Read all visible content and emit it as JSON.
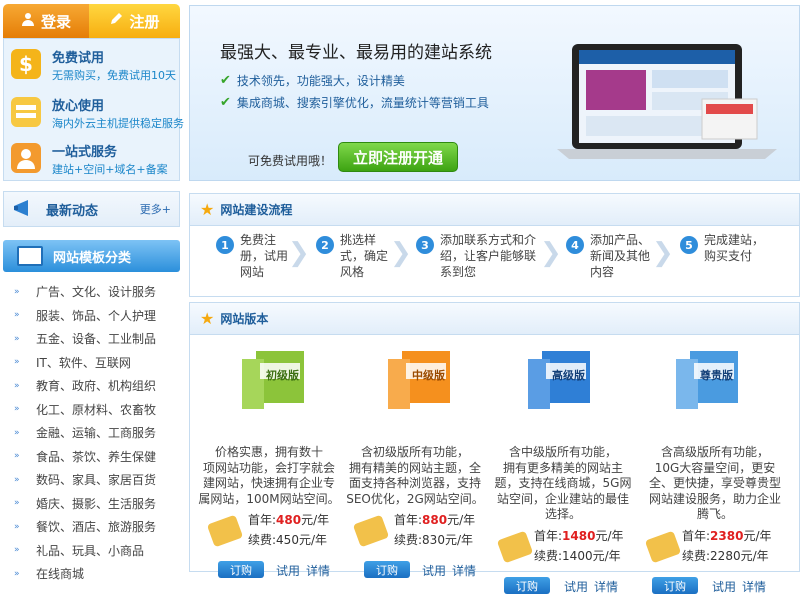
{
  "auth": {
    "login_label": "登录",
    "register_label": "注册"
  },
  "perks": [
    {
      "title": "免费试用",
      "desc": "无需购买，免费试用10天",
      "icon": "dollar-icon"
    },
    {
      "title": "放心使用",
      "desc": "海内外云主机提供稳定服务",
      "icon": "server-icon"
    },
    {
      "title": "一站式服务",
      "desc": "建站+空间+域名+备案",
      "icon": "user-service-icon"
    }
  ],
  "news": {
    "title": "最新动态",
    "more": "更多+"
  },
  "templates": {
    "title": "网站模板分类",
    "items": [
      "广告、文化、设计服务",
      "服装、饰品、个人护理",
      "五金、设备、工业制品",
      "IT、软件、互联网",
      "教育、政府、机构组织",
      "化工、原材料、农畜牧",
      "金融、运输、工商服务",
      "食品、茶饮、养生保健",
      "数码、家具、家居百货",
      "婚庆、摄影、生活服务",
      "餐饮、酒店、旅游服务",
      "礼品、玩具、小商品",
      "在线商城"
    ]
  },
  "banner": {
    "title": "最强大、最专业、最易用的建站系统",
    "bullets": [
      "技术领先，功能强大，设计精美",
      "集成商城、搜索引擎优化，流量统计等营销工具"
    ],
    "try_text": "可免费试用哦！",
    "register_button": "立即注册开通"
  },
  "process": {
    "title": "网站建设流程",
    "steps": [
      {
        "num": "1",
        "text": [
          "免费注",
          "册，试用",
          "网站"
        ]
      },
      {
        "num": "2",
        "text": [
          "挑选样",
          "式，确定",
          "风格"
        ]
      },
      {
        "num": "3",
        "text": [
          "添加联系方式和介",
          "绍，让客户能够联",
          "系到您"
        ]
      },
      {
        "num": "4",
        "text": [
          "添加产品、",
          "新闻及其他",
          "内容"
        ]
      },
      {
        "num": "5",
        "text": [
          "完成建站，",
          "购买支付"
        ]
      }
    ]
  },
  "versions": {
    "title": "网站版本",
    "items": [
      {
        "name": "初级版",
        "desc": [
          "价格实惠，拥有数十",
          "项网站功能，会打字就会",
          "建网站，快速拥有企业专",
          "属网站，100M网站空间。"
        ],
        "first_label": "首年:",
        "first_price": "480",
        "unit": "元/年",
        "renew_label": "续费:",
        "renew_price": "450元/年",
        "buy": "订购",
        "trial": "试用",
        "detail": "详情",
        "color": "#8cc43a"
      },
      {
        "name": "中级版",
        "desc": [
          "含初级版所有功能，",
          "拥有精美的网站主题，全",
          "面支持各种浏览器，支持",
          "SEO优化，2G网站空间。"
        ],
        "first_label": "首年:",
        "first_price": "880",
        "unit": "元/年",
        "renew_label": "续费:",
        "renew_price": "830元/年",
        "buy": "订购",
        "trial": "试用",
        "detail": "详情",
        "color": "#f5901e"
      },
      {
        "name": "高级版",
        "desc": [
          "含中级版所有功能，",
          "拥有更多精美的网站主",
          "题，支持在线商城，5G网",
          "站空间，企业建站的最佳",
          "选择。"
        ],
        "first_label": "首年:",
        "first_price": "1480",
        "unit": "元/年",
        "renew_label": "续费:",
        "renew_price": "1400元/年",
        "buy": "订购",
        "trial": "试用",
        "detail": "详情",
        "color": "#2f7fd6"
      },
      {
        "name": "尊贵版",
        "desc": [
          "含高级版所有功能，",
          "10G大容量空间，更安",
          "全、更快捷，享受尊贵型",
          "网站建设服务，助力企业",
          "腾飞。"
        ],
        "first_label": "首年:",
        "first_price": "2380",
        "unit": "元/年",
        "renew_label": "续费:",
        "renew_price": "2280元/年",
        "buy": "订购",
        "trial": "试用",
        "detail": "详情",
        "color": "#4a9be0"
      }
    ]
  }
}
